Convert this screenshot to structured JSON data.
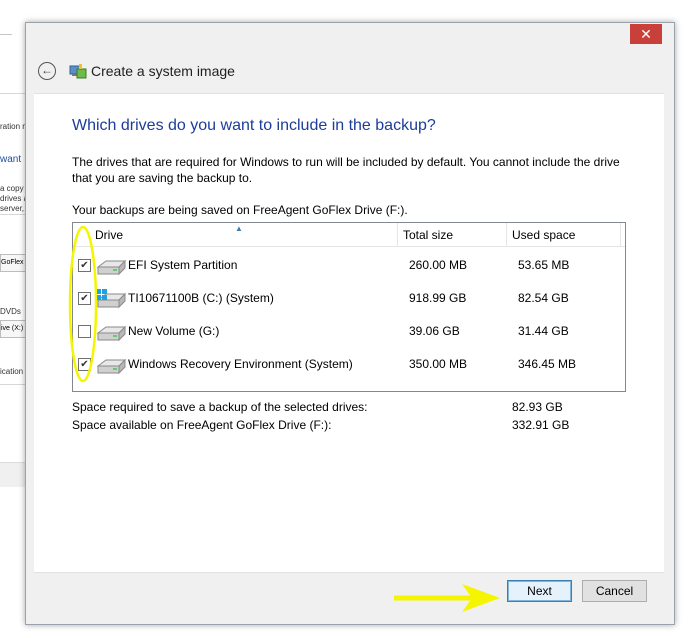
{
  "background_window": {
    "fragments": [
      "ration m",
      "want",
      "a copy o",
      "drives ar",
      "server, yo",
      "GoFlex D",
      "DVDs",
      "ive (X:)",
      "ication"
    ]
  },
  "titlebar": {
    "close_glyph": "✕"
  },
  "nav": {
    "back_glyph": "←",
    "title": "Create a system image"
  },
  "content": {
    "heading": "Which drives do you want to include in the backup?",
    "description": "The drives that are required for Windows to run will be included by default. You cannot include the drive that you are saving the backup to.",
    "saving_location": "Your backups are being saved on FreeAgent GoFlex Drive (F:).",
    "table": {
      "headers": {
        "drive": "Drive",
        "total": "Total size",
        "used": "Used space"
      },
      "rows": [
        {
          "checked": true,
          "icon": "hard-drive-icon",
          "name": "EFI System Partition",
          "total": "260.00 MB",
          "used": "53.65 MB"
        },
        {
          "checked": true,
          "icon": "windows-system-drive-icon",
          "name": "TI10671100B (C:) (System)",
          "total": "918.99 GB",
          "used": "82.54 GB"
        },
        {
          "checked": false,
          "icon": "hard-drive-icon",
          "name": "New Volume (G:)",
          "total": "39.06 GB",
          "used": "31.44 GB"
        },
        {
          "checked": true,
          "icon": "hard-drive-icon",
          "name": "Windows Recovery Environment (System)",
          "total": "350.00 MB",
          "used": "346.45 MB"
        }
      ]
    },
    "summary": {
      "required_label": "Space required to save a backup of the selected drives:",
      "required_value": "82.93 GB",
      "available_label": "Space available on FreeAgent GoFlex Drive (F:):",
      "available_value": "332.91 GB"
    }
  },
  "footer": {
    "next_label": "Next",
    "cancel_label": "Cancel"
  },
  "colors": {
    "heading": "#1c3d9a",
    "close": "#c9403a",
    "annotation": "#f5f500"
  }
}
